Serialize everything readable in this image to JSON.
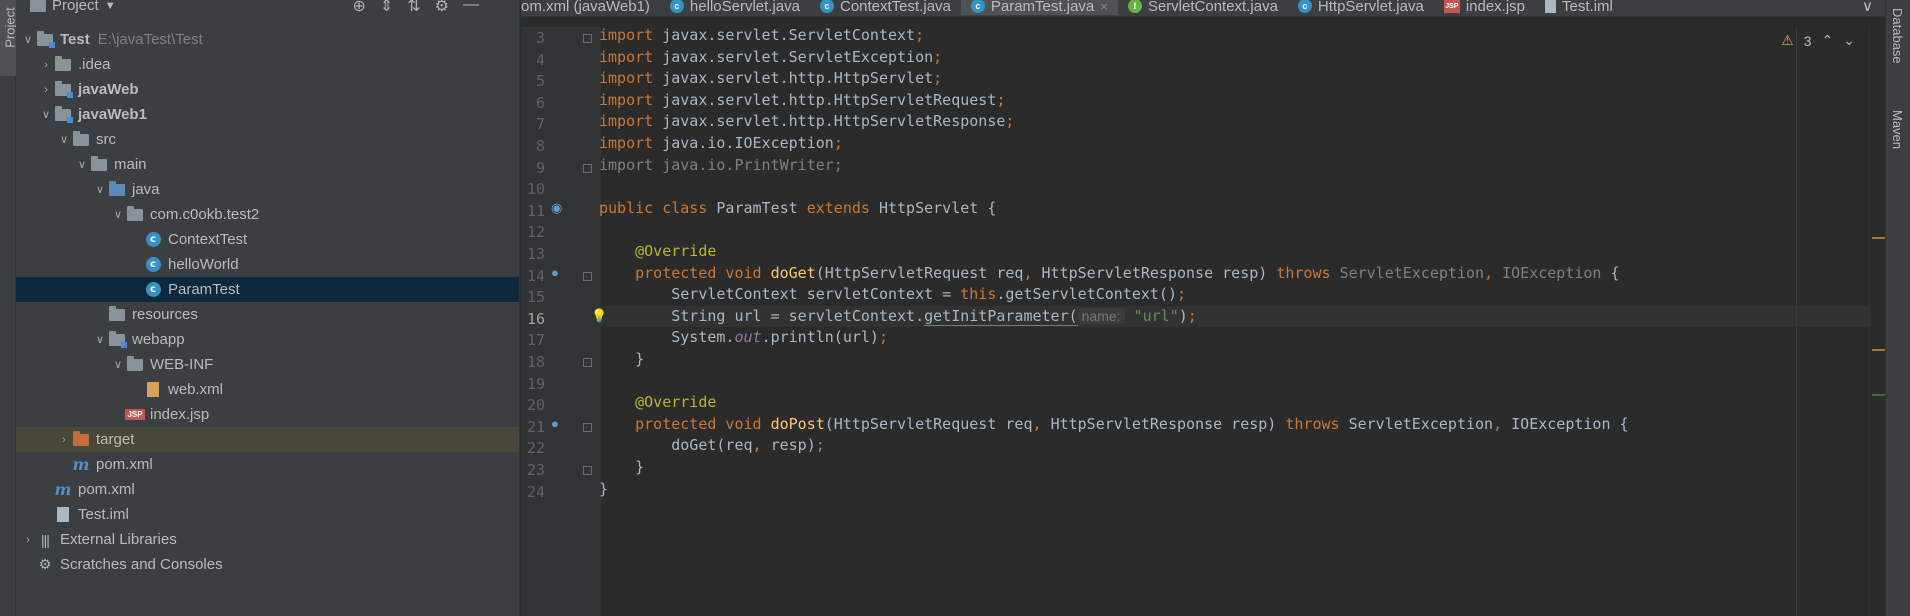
{
  "left_strip": {
    "label": "Project"
  },
  "project_panel": {
    "title": "Project",
    "tools": [
      "⊕",
      "⇕",
      "⇅",
      "⚙",
      "—"
    ],
    "tree": [
      {
        "indent": 0,
        "arrow": "∨",
        "icon": "folder-mod",
        "label": "Test",
        "bold": true,
        "path": "E:\\javaTest\\Test"
      },
      {
        "indent": 1,
        "arrow": "›",
        "icon": "folder",
        "label": ".idea"
      },
      {
        "indent": 1,
        "arrow": "›",
        "icon": "folder-mod",
        "label": "javaWeb",
        "bold": true
      },
      {
        "indent": 1,
        "arrow": "∨",
        "icon": "folder-mod",
        "label": "javaWeb1",
        "bold": true
      },
      {
        "indent": 2,
        "arrow": "∨",
        "icon": "folder",
        "label": "src"
      },
      {
        "indent": 3,
        "arrow": "∨",
        "icon": "folder",
        "label": "main"
      },
      {
        "indent": 4,
        "arrow": "∨",
        "icon": "folder-blue",
        "label": "java"
      },
      {
        "indent": 5,
        "arrow": "∨",
        "icon": "folder",
        "label": "com.c0okb.test2"
      },
      {
        "indent": 6,
        "arrow": "",
        "icon": "class",
        "label": "ContextTest"
      },
      {
        "indent": 6,
        "arrow": "",
        "icon": "class",
        "label": "helloWorld"
      },
      {
        "indent": 6,
        "arrow": "",
        "icon": "class",
        "label": "ParamTest",
        "selected": true
      },
      {
        "indent": 4,
        "arrow": "",
        "icon": "folder",
        "label": "resources"
      },
      {
        "indent": 4,
        "arrow": "∨",
        "icon": "folder-mod",
        "label": "webapp"
      },
      {
        "indent": 5,
        "arrow": "∨",
        "icon": "folder",
        "label": "WEB-INF"
      },
      {
        "indent": 6,
        "arrow": "",
        "icon": "xml",
        "label": "web.xml"
      },
      {
        "indent": 5,
        "arrow": "",
        "icon": "jsp",
        "label": "index.jsp"
      },
      {
        "indent": 2,
        "arrow": "›",
        "icon": "folder-orange",
        "label": "target",
        "excluded": true
      },
      {
        "indent": 2,
        "arrow": "",
        "icon": "maven",
        "label": "pom.xml"
      },
      {
        "indent": 1,
        "arrow": "",
        "icon": "maven",
        "label": "pom.xml"
      },
      {
        "indent": 1,
        "arrow": "",
        "icon": "iml",
        "label": "Test.iml"
      },
      {
        "indent": 0,
        "arrow": "›",
        "icon": "lib",
        "label": "External Libraries"
      },
      {
        "indent": 0,
        "arrow": "",
        "icon": "scratch",
        "label": "Scratches and Consoles"
      }
    ]
  },
  "tabs": [
    {
      "label": "om.xml (javaWeb1)",
      "icon": "maven"
    },
    {
      "label": "helloServlet.java",
      "icon": "class"
    },
    {
      "label": "ContextTest.java",
      "icon": "class"
    },
    {
      "label": "ParamTest.java",
      "icon": "class",
      "active": true,
      "closable": true
    },
    {
      "label": "ServletContext.java",
      "icon": "interface"
    },
    {
      "label": "HttpServlet.java",
      "icon": "class"
    },
    {
      "label": "index.jsp",
      "icon": "jsp"
    },
    {
      "label": "Test.iml",
      "icon": "iml"
    }
  ],
  "editor": {
    "inspection": {
      "warning_count": "3"
    },
    "current_line": 16,
    "lines": [
      {
        "n": "3",
        "tokens": [
          [
            "kw",
            "import "
          ],
          [
            "",
            "javax.servlet.ServletContext"
          ],
          [
            "kw",
            ";"
          ]
        ]
      },
      {
        "n": "4",
        "tokens": [
          [
            "kw",
            "import "
          ],
          [
            "",
            "javax.servlet.ServletException"
          ],
          [
            "kw",
            ";"
          ]
        ]
      },
      {
        "n": "5",
        "tokens": [
          [
            "kw",
            "import "
          ],
          [
            "",
            "javax.servlet.http.HttpServlet"
          ],
          [
            "kw",
            ";"
          ]
        ]
      },
      {
        "n": "6",
        "tokens": [
          [
            "kw",
            "import "
          ],
          [
            "",
            "javax.servlet.http.HttpServletRequest"
          ],
          [
            "kw",
            ";"
          ]
        ]
      },
      {
        "n": "7",
        "tokens": [
          [
            "kw",
            "import "
          ],
          [
            "",
            "javax.servlet.http.HttpServletResponse"
          ],
          [
            "kw",
            ";"
          ]
        ]
      },
      {
        "n": "8",
        "tokens": [
          [
            "kw",
            "import "
          ],
          [
            "",
            "java.io.IOException"
          ],
          [
            "kw",
            ";"
          ]
        ]
      },
      {
        "n": "9",
        "tokens": [
          [
            "unused",
            "import java.io.PrintWriter;"
          ]
        ]
      },
      {
        "n": "10",
        "tokens": []
      },
      {
        "n": "11",
        "tokens": [
          [
            "kw",
            "public class "
          ],
          [
            "",
            "ParamTest "
          ],
          [
            "kw",
            "extends "
          ],
          [
            "",
            "HttpServlet {"
          ]
        ]
      },
      {
        "n": "12",
        "tokens": []
      },
      {
        "n": "13",
        "tokens": [
          [
            "",
            "    "
          ],
          [
            "ann",
            "@Override"
          ]
        ]
      },
      {
        "n": "14",
        "tokens": [
          [
            "",
            "    "
          ],
          [
            "kw",
            "protected void "
          ],
          [
            "fn",
            "doGet"
          ],
          [
            "",
            "(HttpServletRequest req"
          ],
          [
            "kw",
            ", "
          ],
          [
            "",
            "HttpServletResponse resp) "
          ],
          [
            "kw",
            "throws "
          ],
          [
            "dim",
            "ServletException"
          ],
          [
            "kw",
            ", "
          ],
          [
            "dim",
            "IOException"
          ],
          [
            "",
            " {"
          ]
        ]
      },
      {
        "n": "15",
        "tokens": [
          [
            "",
            "        ServletContext servletContext = "
          ],
          [
            "kw",
            "this"
          ],
          [
            "",
            ".getServletContext()"
          ],
          [
            "kw",
            ";"
          ]
        ]
      },
      {
        "n": "16",
        "tokens": [
          [
            "",
            "        String url = servletContext."
          ],
          [
            "uline",
            "getInitParameter("
          ],
          [
            "hint",
            "name:"
          ],
          [
            "",
            " "
          ],
          [
            "str",
            "\"url\""
          ],
          [
            "",
            ")"
          ],
          [
            "kw",
            ";"
          ]
        ]
      },
      {
        "n": "17",
        "tokens": [
          [
            "",
            "        System."
          ],
          [
            "static",
            "out"
          ],
          [
            "",
            ".println(url)"
          ],
          [
            "kw",
            ";"
          ]
        ]
      },
      {
        "n": "18",
        "tokens": [
          [
            "",
            "    }"
          ]
        ]
      },
      {
        "n": "19",
        "tokens": []
      },
      {
        "n": "20",
        "tokens": [
          [
            "",
            "    "
          ],
          [
            "ann",
            "@Override"
          ]
        ]
      },
      {
        "n": "21",
        "tokens": [
          [
            "",
            "    "
          ],
          [
            "kw",
            "protected void "
          ],
          [
            "fn",
            "doPost"
          ],
          [
            "",
            "(HttpServletRequest req"
          ],
          [
            "kw",
            ", "
          ],
          [
            "",
            "HttpServletResponse resp) "
          ],
          [
            "kw",
            "throws "
          ],
          [
            "",
            "ServletException"
          ],
          [
            "kw",
            ", "
          ],
          [
            "",
            "IOException {"
          ]
        ]
      },
      {
        "n": "22",
        "tokens": [
          [
            "",
            "        doGet(req"
          ],
          [
            "kw",
            ", "
          ],
          [
            "",
            "resp)"
          ],
          [
            "kw",
            ";"
          ]
        ]
      },
      {
        "n": "23",
        "tokens": [
          [
            "",
            "    }"
          ]
        ]
      },
      {
        "n": "24",
        "tokens": [
          [
            "",
            "}"
          ]
        ]
      }
    ]
  },
  "right_strip": {
    "labels": [
      "Database",
      "Maven"
    ]
  }
}
